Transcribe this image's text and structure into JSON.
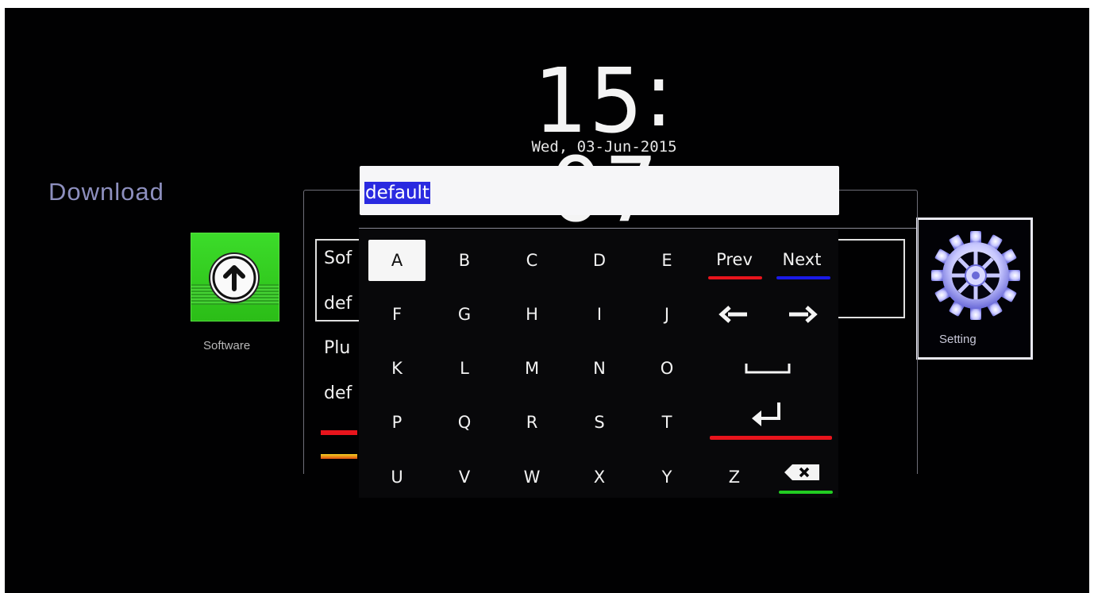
{
  "clock": {
    "hours": "15",
    "separator": ":",
    "minutes": "07"
  },
  "date": "Wed, 03-Jun-2015",
  "section_title": "Download",
  "tiles": {
    "software": {
      "label": "Software",
      "icon": "upload-arrow-icon",
      "color": "#33cc22"
    },
    "setting": {
      "label": "Setting",
      "icon": "gear-icon",
      "color": "#b8b8ff"
    }
  },
  "background_list": {
    "items": [
      "Sof",
      "def",
      "Plu",
      "def"
    ],
    "color_keys": [
      "#e8141c",
      "#f0a020"
    ]
  },
  "input": {
    "value": "default",
    "highlight": "#2a2ae0"
  },
  "keyboard": {
    "selected": "A",
    "rows": [
      [
        "A",
        "B",
        "C",
        "D",
        "E"
      ],
      [
        "F",
        "G",
        "H",
        "I",
        "J"
      ],
      [
        "K",
        "L",
        "M",
        "N",
        "O"
      ],
      [
        "P",
        "Q",
        "R",
        "S",
        "T"
      ],
      [
        "U",
        "V",
        "W",
        "X",
        "Y",
        "Z"
      ]
    ],
    "prev_label": "Prev",
    "next_label": "Next",
    "prev_color": "#e8141c",
    "next_color": "#1a1ae8",
    "enter_color": "#e8141c",
    "backspace_color": "#22cc22",
    "icons": [
      "arrow-left-icon",
      "arrow-right-icon",
      "space-icon",
      "enter-icon",
      "backspace-icon"
    ]
  }
}
